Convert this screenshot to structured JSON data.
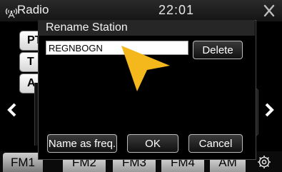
{
  "header": {
    "title": "Radio",
    "clock": "22:01"
  },
  "presets": {
    "items": [
      {
        "label": "PT"
      },
      {
        "label": "T"
      },
      {
        "label": "A"
      }
    ]
  },
  "bands": {
    "fm1": "FM1",
    "fm2": "FM2",
    "fm3": "FM3",
    "fm4": "FM4",
    "am": "AM"
  },
  "dialog": {
    "title": "Rename Station",
    "input_value": "REGNBOGN",
    "delete_label": "Delete",
    "name_as_freq_label": "Name as freq.",
    "ok_label": "OK",
    "cancel_label": "Cancel"
  },
  "colors": {
    "pointer": "#f5b81c",
    "dialog_background": "#000000",
    "button_border": "#bbbbbb"
  },
  "icons": {
    "radio": "radio-antenna-icon",
    "close": "close-icon",
    "left": "chevron-left-icon",
    "right": "chevron-right-icon",
    "settings": "gear-icon",
    "pointer": "pointer-arrow-icon"
  }
}
